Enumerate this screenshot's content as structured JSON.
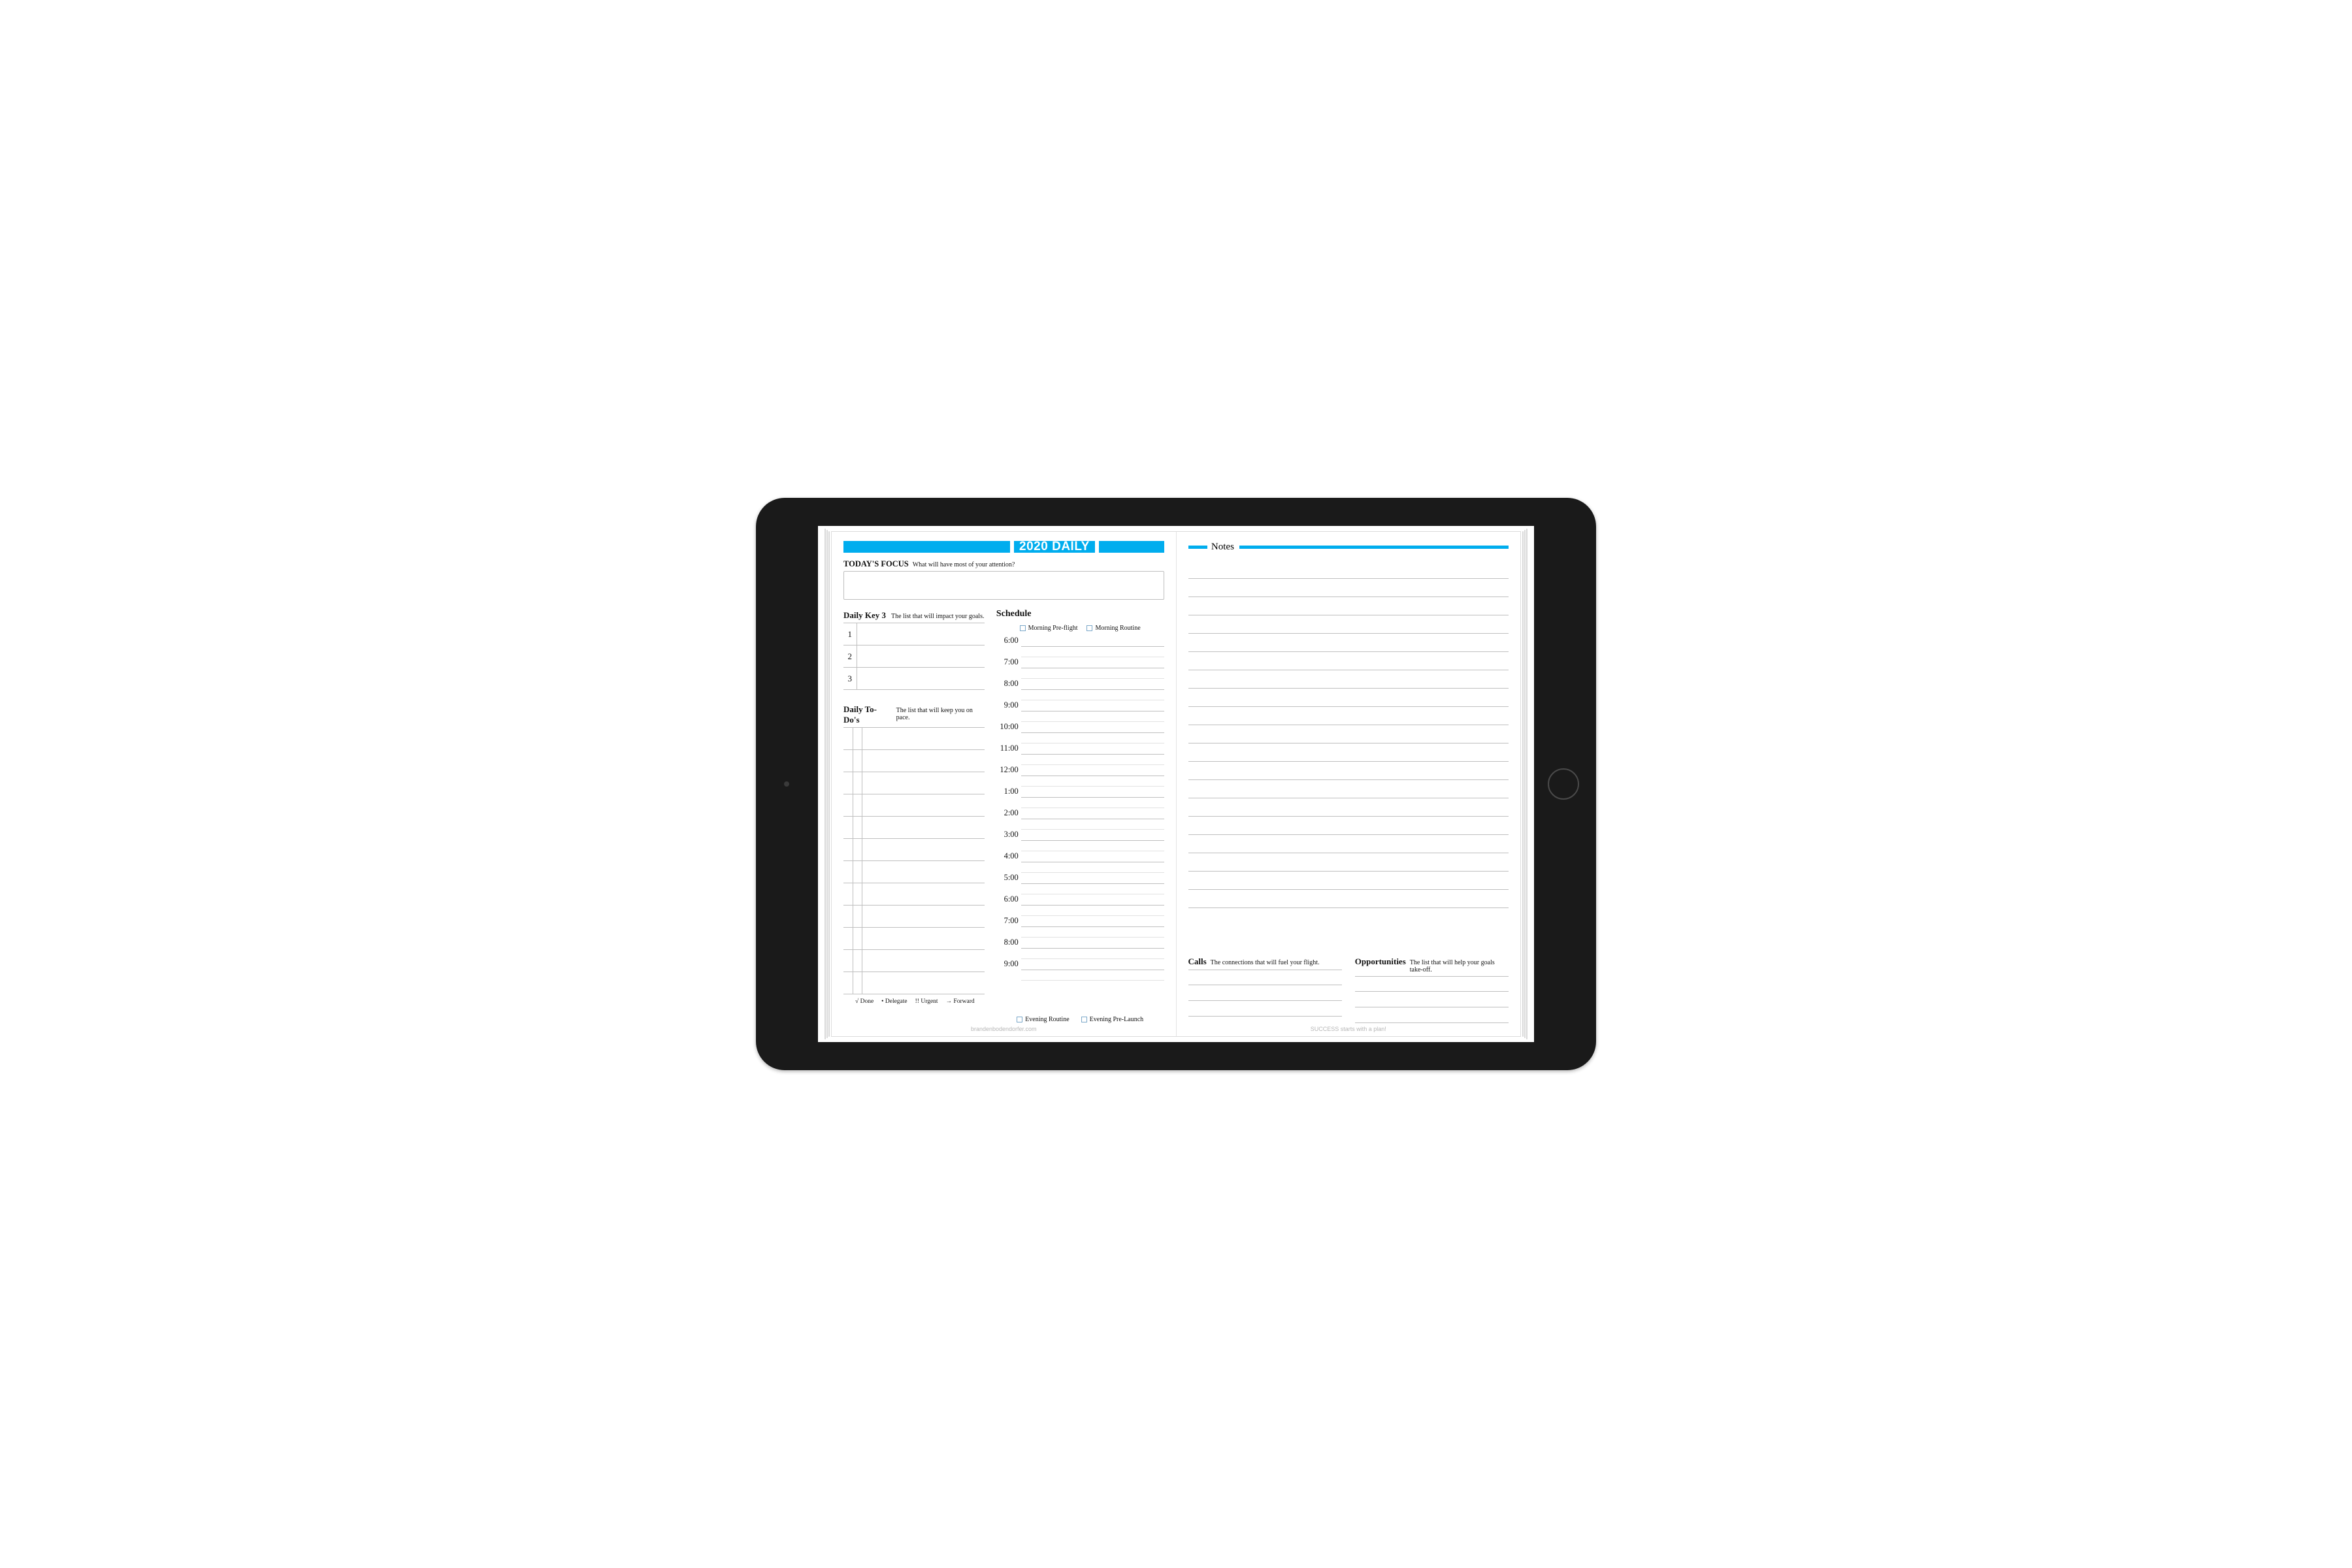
{
  "header": {
    "title": "2020 DAILY"
  },
  "focus": {
    "heading": "TODAY'S FOCUS",
    "sub": "What will have most of your attention?"
  },
  "key3": {
    "heading": "Daily Key 3",
    "sub": "The list that will impact your goals.",
    "rows": [
      "1",
      "2",
      "3"
    ]
  },
  "todos": {
    "heading": "Daily To-Do's",
    "sub": "The list that will keep you on pace.",
    "row_count": 12,
    "legend": {
      "done": "√ Done",
      "delegate": "• Delegate",
      "urgent": "!! Urgent",
      "forward": "→ Forward"
    }
  },
  "schedule": {
    "heading": "Schedule",
    "morning": {
      "preflight": "Morning Pre-flight",
      "routine": "Morning Routine"
    },
    "times": [
      "6:00",
      "7:00",
      "8:00",
      "9:00",
      "10:00",
      "11:00",
      "12:00",
      "1:00",
      "2:00",
      "3:00",
      "4:00",
      "5:00",
      "6:00",
      "7:00",
      "8:00",
      "9:00"
    ],
    "evening": {
      "routine": "Evening Routine",
      "prelaunch": "Evening Pre-Launch"
    }
  },
  "right": {
    "notes_heading": "Notes",
    "notes_line_count": 19,
    "calls": {
      "heading": "Calls",
      "sub": "The connections that will fuel your flight."
    },
    "opps": {
      "heading": "Opportunities",
      "sub": "The list that will help your goals take-off."
    },
    "mini_line_count": 3
  },
  "footers": {
    "left": "brandenbodendorfer.com",
    "right": "SUCCESS starts with a plan!"
  },
  "colors": {
    "accent": "#00adee"
  }
}
